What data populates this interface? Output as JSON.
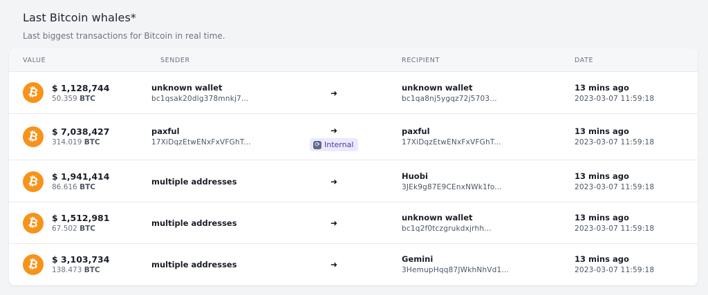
{
  "header": {
    "title": "Last Bitcoin whales*",
    "subtitle": "Last biggest transactions for Bitcoin in real time."
  },
  "table": {
    "columns": {
      "value": "VALUE",
      "sender": "SENDER",
      "recipient": "RECIPIENT",
      "date": "DATE"
    },
    "arrow": "➜",
    "coin_icon": "bitcoin-icon",
    "coin_color": "#f7931a",
    "rows": [
      {
        "usd": "$ 1,128,744",
        "btc_amount": "50.359",
        "btc_unit": "BTC",
        "sender_name": "unknown wallet",
        "sender_addr": "bc1qsak20dlg378mnkj7...",
        "recipient_name": "unknown wallet",
        "recipient_addr": "bc1qa8nj5ygqz72j5703...",
        "when": "13 mins ago",
        "date": "2023-03-07 11:59:18"
      },
      {
        "usd": "$ 7,038,427",
        "btc_amount": "314.019",
        "btc_unit": "BTC",
        "sender_name": "paxful",
        "sender_addr": "17XiDqzEtwENxFxVFGhT...",
        "badge": "Internal",
        "recipient_name": "paxful",
        "recipient_addr": "17XiDqzEtwENxFxVFGhT...",
        "when": "13 mins ago",
        "date": "2023-03-07 11:59:18"
      },
      {
        "usd": "$ 1,941,414",
        "btc_amount": "86.616",
        "btc_unit": "BTC",
        "sender_name": "multiple addresses",
        "recipient_name": "Huobi",
        "recipient_addr": "3JEk9g87E9CEnxNWk1fo...",
        "when": "13 mins ago",
        "date": "2023-03-07 11:59:18"
      },
      {
        "usd": "$ 1,512,981",
        "btc_amount": "67.502",
        "btc_unit": "BTC",
        "sender_name": "multiple addresses",
        "recipient_name": "unknown wallet",
        "recipient_addr": "bc1q2f0tczgrukdxjrhh...",
        "when": "13 mins ago",
        "date": "2023-03-07 11:59:18"
      },
      {
        "usd": "$ 3,103,734",
        "btc_amount": "138.473",
        "btc_unit": "BTC",
        "sender_name": "multiple addresses",
        "recipient_name": "Gemini",
        "recipient_addr": "3HemupHqq87JWkhNhVd1...",
        "when": "13 mins ago",
        "date": "2023-03-07 11:59:18"
      }
    ]
  }
}
